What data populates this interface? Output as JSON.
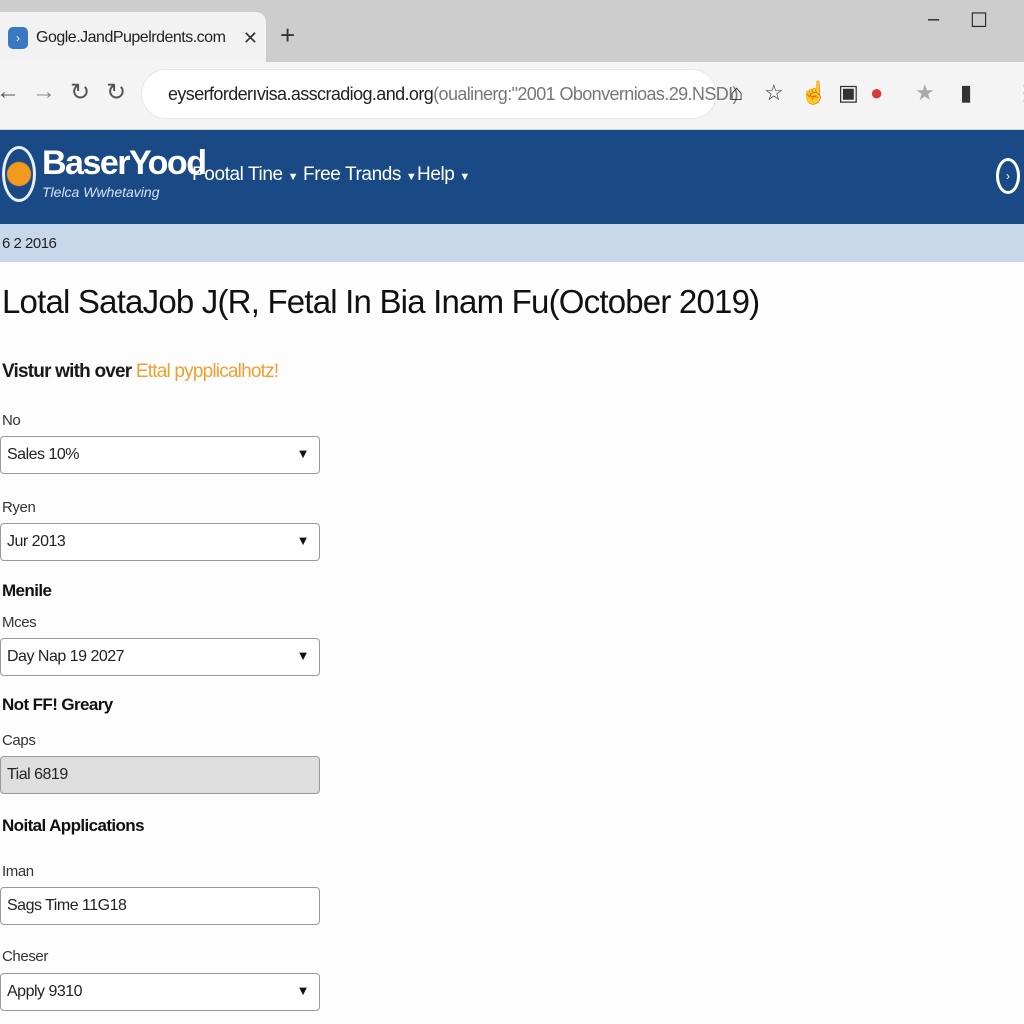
{
  "browser": {
    "tab_title": "Gogle.JandPupelrdents.com",
    "url_host": "eyserforderıvisa.asscradiog.and.org",
    "url_query": "(oualinerg:\"2001 Obonvernioas.29.NSDI)"
  },
  "site": {
    "brand": "BaserYood",
    "tagline": "Tlelca Wwhetaving",
    "menu": [
      {
        "label": "Pootal Tine"
      },
      {
        "label": "Free Trands"
      },
      {
        "label": "Help"
      }
    ],
    "date": "6 2 2016"
  },
  "page": {
    "title": "Lotal  SataJob J(R, Fetal In Bia Inam Fu(October 2019)",
    "subtitle_prefix": "Vistur with over",
    "subtitle_highlight": "Ettal pypplicalhotz!"
  },
  "form": {
    "f1": {
      "label": "No",
      "value": "Sales 10%"
    },
    "f2": {
      "label": "Ryen",
      "value": "Jur 2013"
    },
    "section1": "Menile",
    "f3": {
      "label": "Mces",
      "value": "Day Nap 19 2027"
    },
    "section2": "Not FF! Greary",
    "f4": {
      "label": "Caps",
      "value": "Tial 6819"
    },
    "section3": "Noital Applications",
    "f5": {
      "label": "Iman",
      "value": "Sags Time 11G18"
    },
    "f6": {
      "label": "Cheser",
      "value": "Apply 9310"
    }
  },
  "colors": {
    "header": "#1a4a86",
    "datebar": "#c7d8ea",
    "highlight": "#f0a030"
  }
}
